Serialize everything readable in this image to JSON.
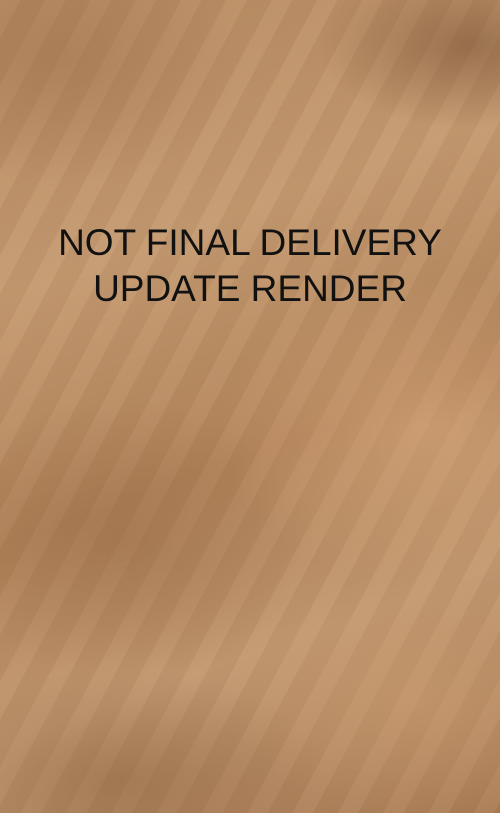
{
  "message": {
    "line1": "NOT FINAL DELIVERY",
    "line2": "UPDATE RENDER"
  },
  "colors": {
    "background": "#b8875c",
    "text": "#111111"
  }
}
